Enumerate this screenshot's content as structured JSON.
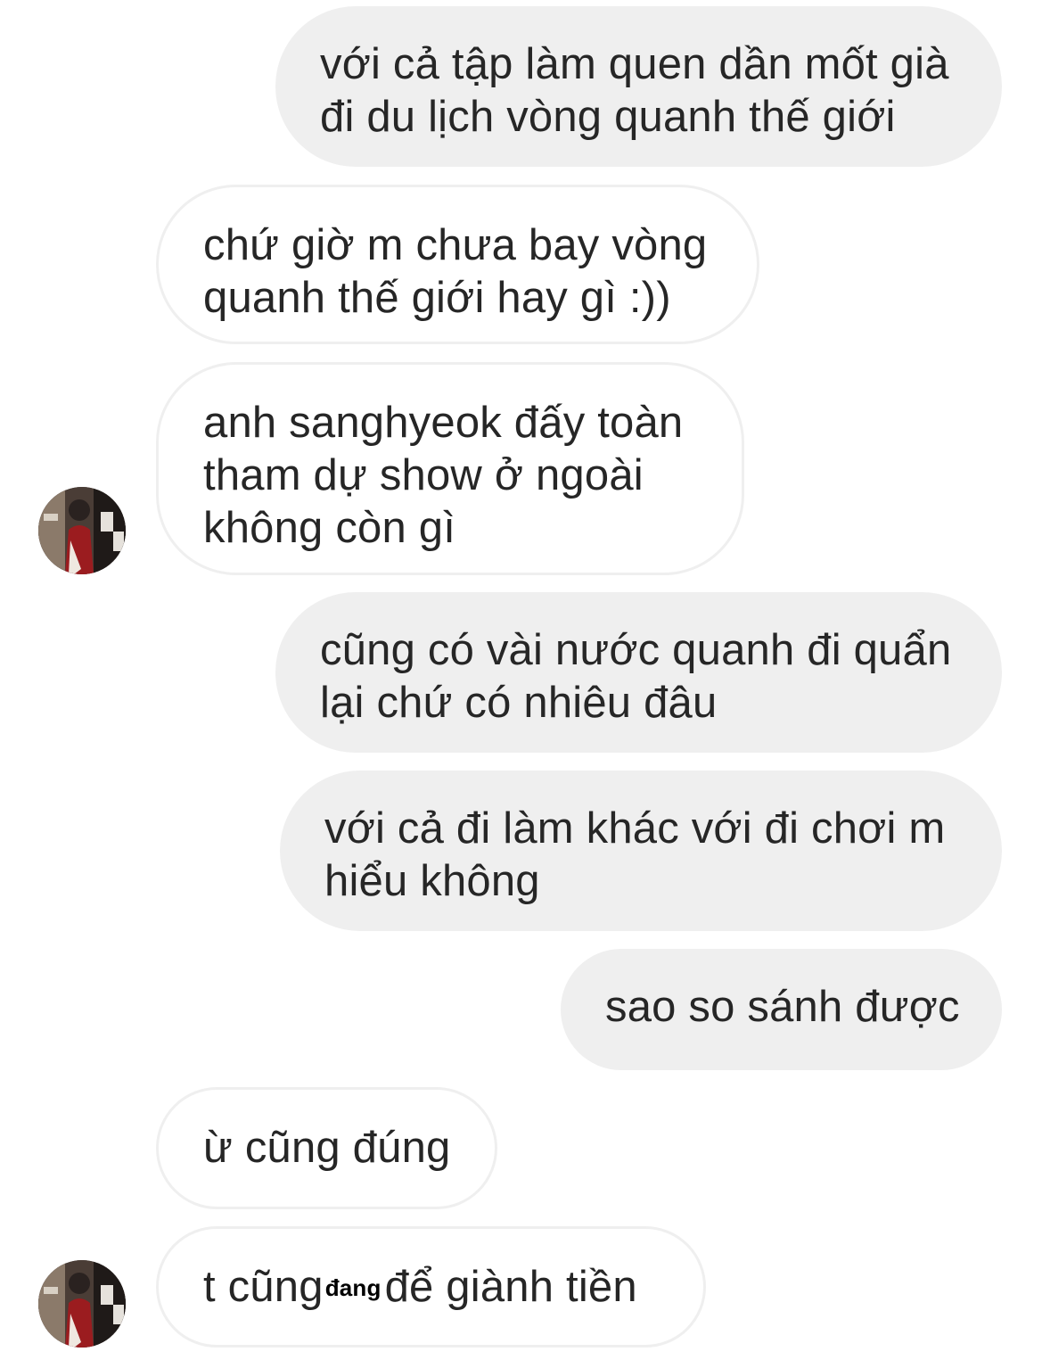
{
  "messages": [
    {
      "side": "sent",
      "lines": [
        "với cả tập làm quen dần mốt già",
        "đi du lịch vòng quanh thế giới"
      ]
    },
    {
      "side": "received",
      "lines": [
        "chứ giờ m chưa bay vòng",
        "quanh thế giới hay gì :))"
      ]
    },
    {
      "side": "received",
      "lines": [
        "anh sanghyeok đấy toàn",
        "tham dự show ở ngoài",
        "không còn gì"
      ]
    },
    {
      "side": "sent",
      "lines": [
        "cũng có vài nước quanh đi quẩn",
        "lại chứ có nhiêu đâu"
      ]
    },
    {
      "side": "sent",
      "lines": [
        "với cả đi làm khác với đi chơi m",
        "hiểu không"
      ]
    },
    {
      "side": "sent",
      "lines": [
        "sao so sánh được"
      ]
    },
    {
      "side": "received",
      "lines": [
        "ừ cũng đúng"
      ]
    },
    {
      "side": "received",
      "parts": [
        "t cũng",
        "đang",
        "để giành tiền"
      ]
    }
  ],
  "avatar": {
    "icon": "user-avatar-photo"
  },
  "colors": {
    "sent_bubble": "#efefef",
    "received_border": "#efefef",
    "text": "#262626",
    "background": "#ffffff"
  }
}
